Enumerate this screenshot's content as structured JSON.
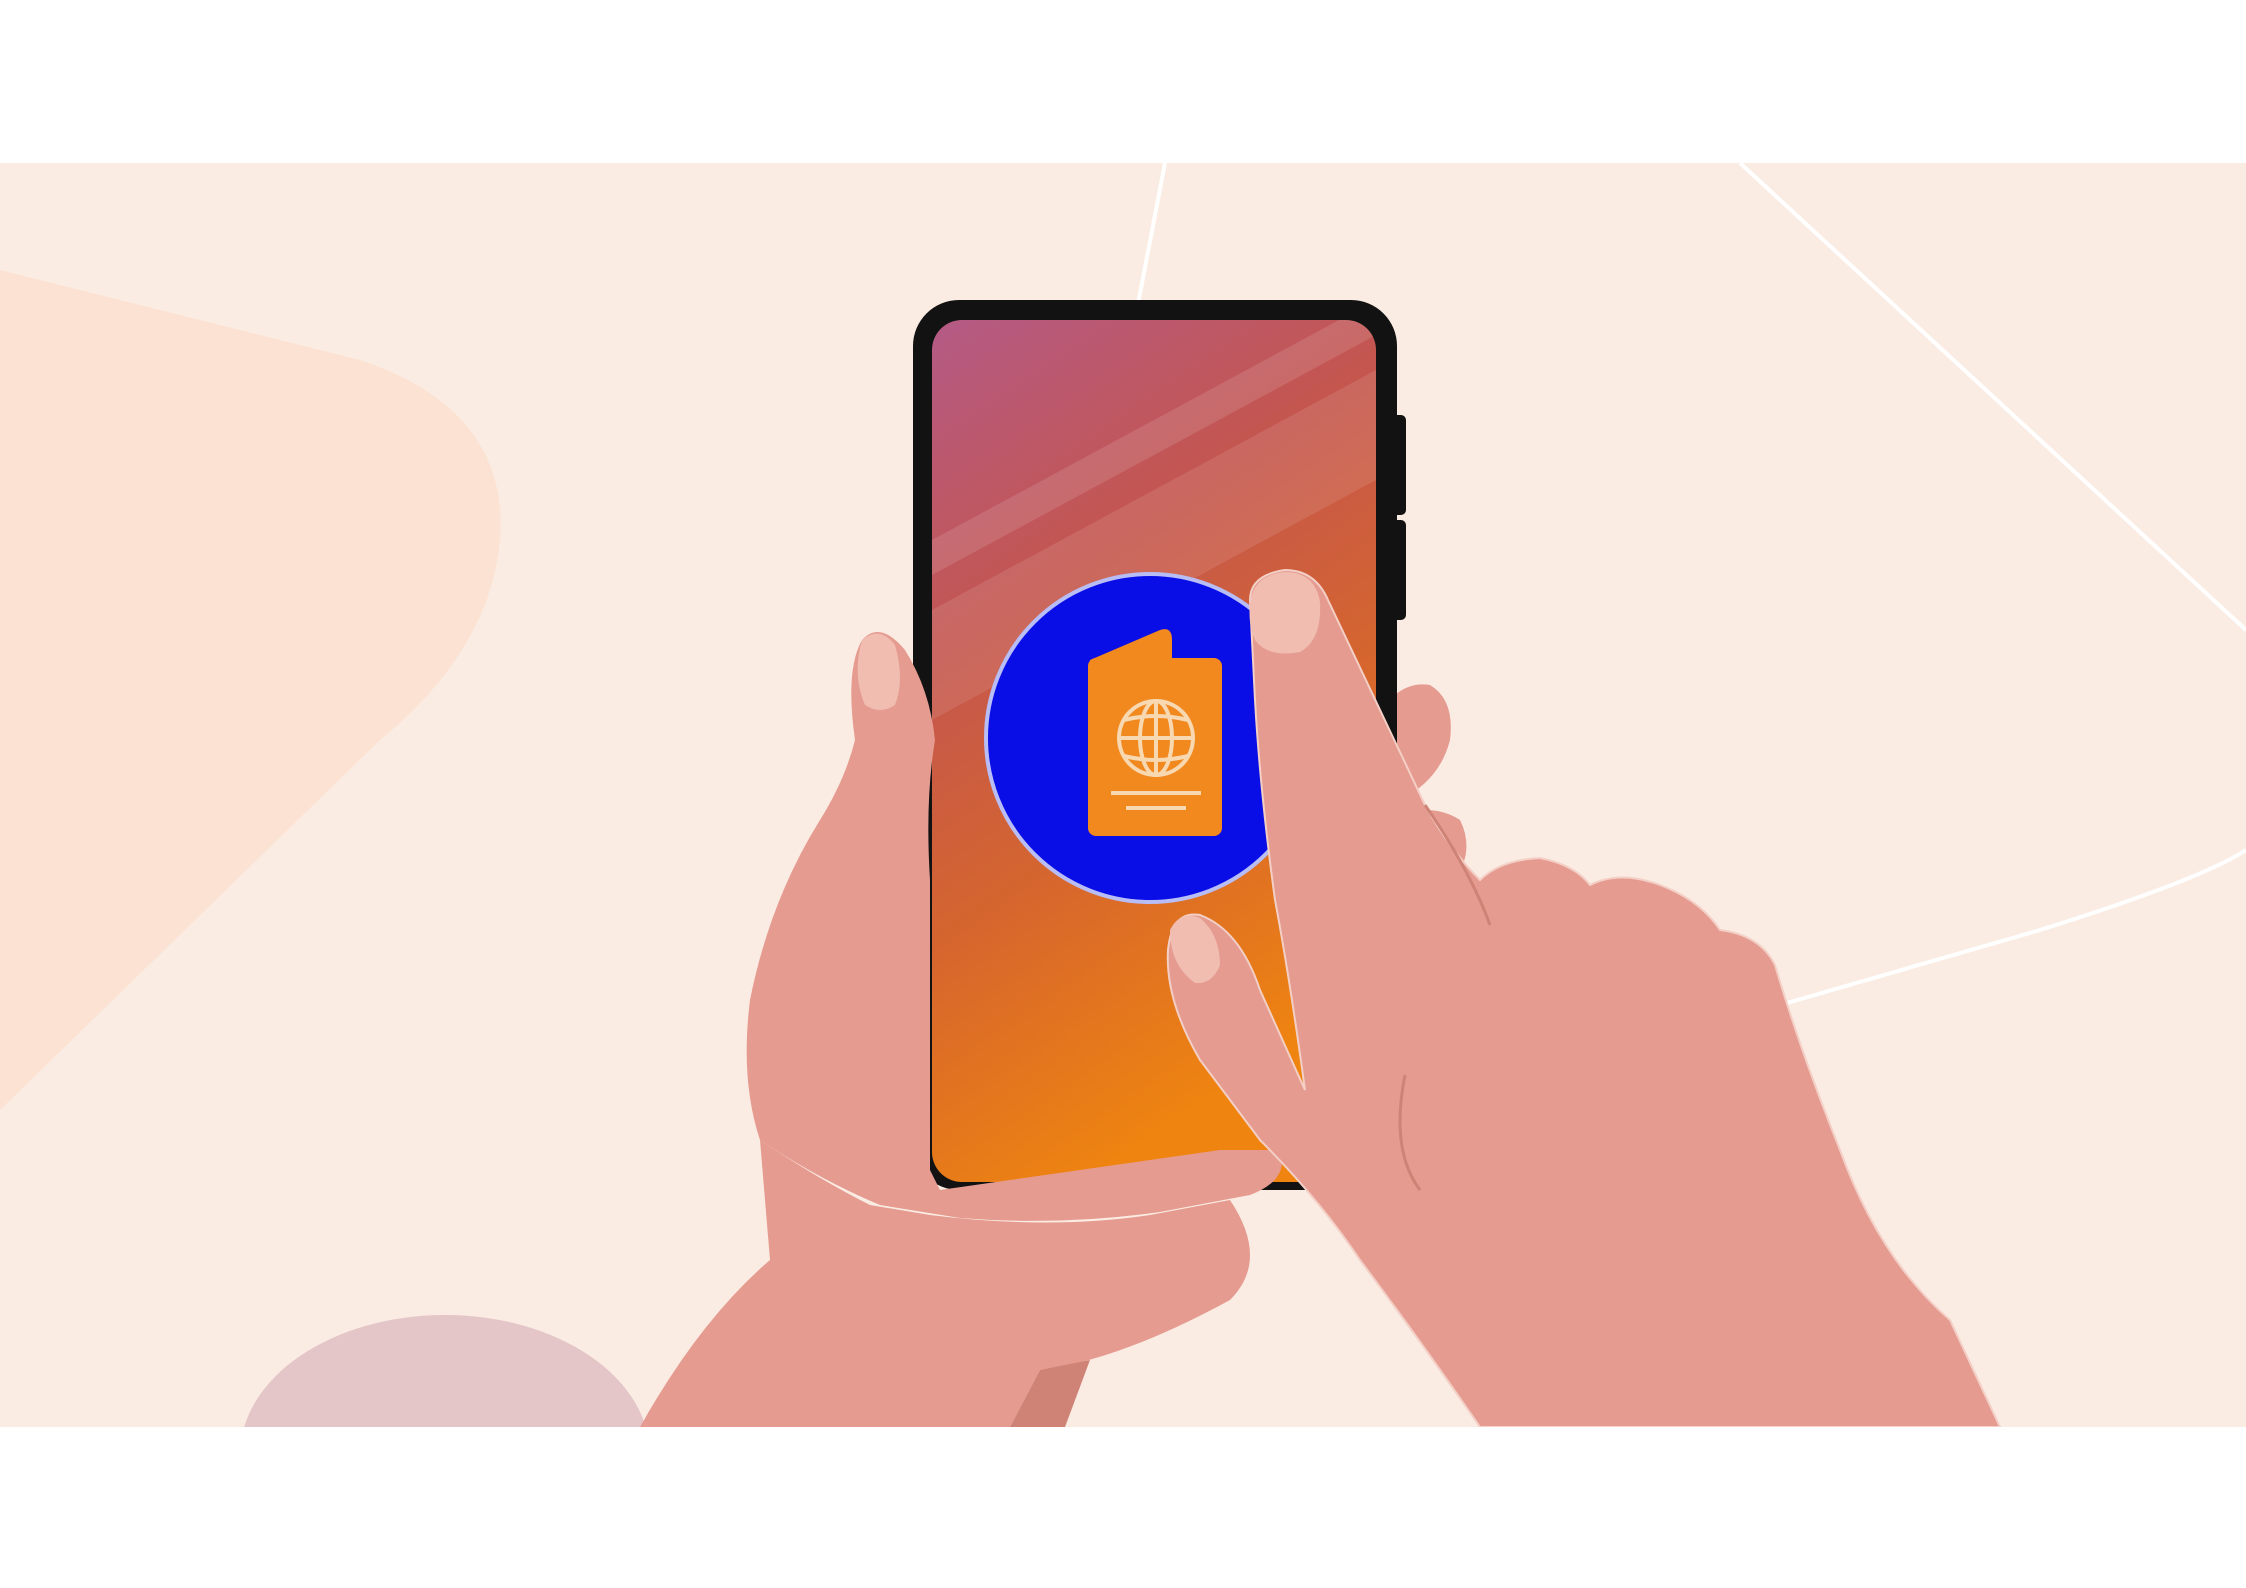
{
  "page": {
    "margin_color": "#ffffff"
  },
  "scene": {
    "background_color": "#fbece3",
    "decor_colors": {
      "peach_shape": "#fbe2d2",
      "lines": "#ffffff",
      "mauve_circle": "#e4c5c8"
    },
    "phone": {
      "body_color": "#121212",
      "screen_gradient": [
        "#b45a86",
        "#c4564f",
        "#d5652e",
        "#ef8410"
      ]
    },
    "app_icon": {
      "name": "passport-icon",
      "circle_color": "#0a0ee6",
      "outline_color": "#b8bdf5",
      "passport_color": "#f1891f",
      "globe_color": "#f7d8b0"
    },
    "hands": {
      "skin_color": "#e59b90",
      "nail_color": "#f0bdb0",
      "shadow_color": "#cf8377"
    }
  }
}
